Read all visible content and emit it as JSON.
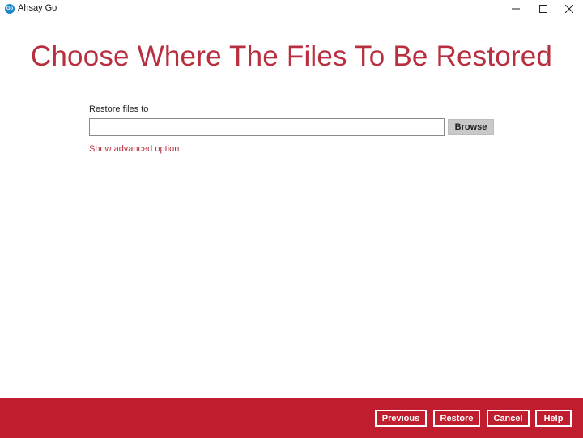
{
  "window": {
    "app_icon_text": "Go",
    "title": "Ahsay Go",
    "minimize_icon": "minimize-icon",
    "maximize_icon": "maximize-icon",
    "close_icon": "close-icon"
  },
  "main": {
    "heading": "Choose Where The Files To Be Restored",
    "restore_label": "Restore files to",
    "restore_path_value": "",
    "browse_label": "Browse",
    "advanced_link": "Show advanced option"
  },
  "footer": {
    "previous_label": "Previous",
    "restore_label": "Restore",
    "cancel_label": "Cancel",
    "help_label": "Help"
  },
  "colors": {
    "accent": "#b8303f",
    "footer_bg": "#c01d2e",
    "browse_bg": "#c9c9c9"
  }
}
